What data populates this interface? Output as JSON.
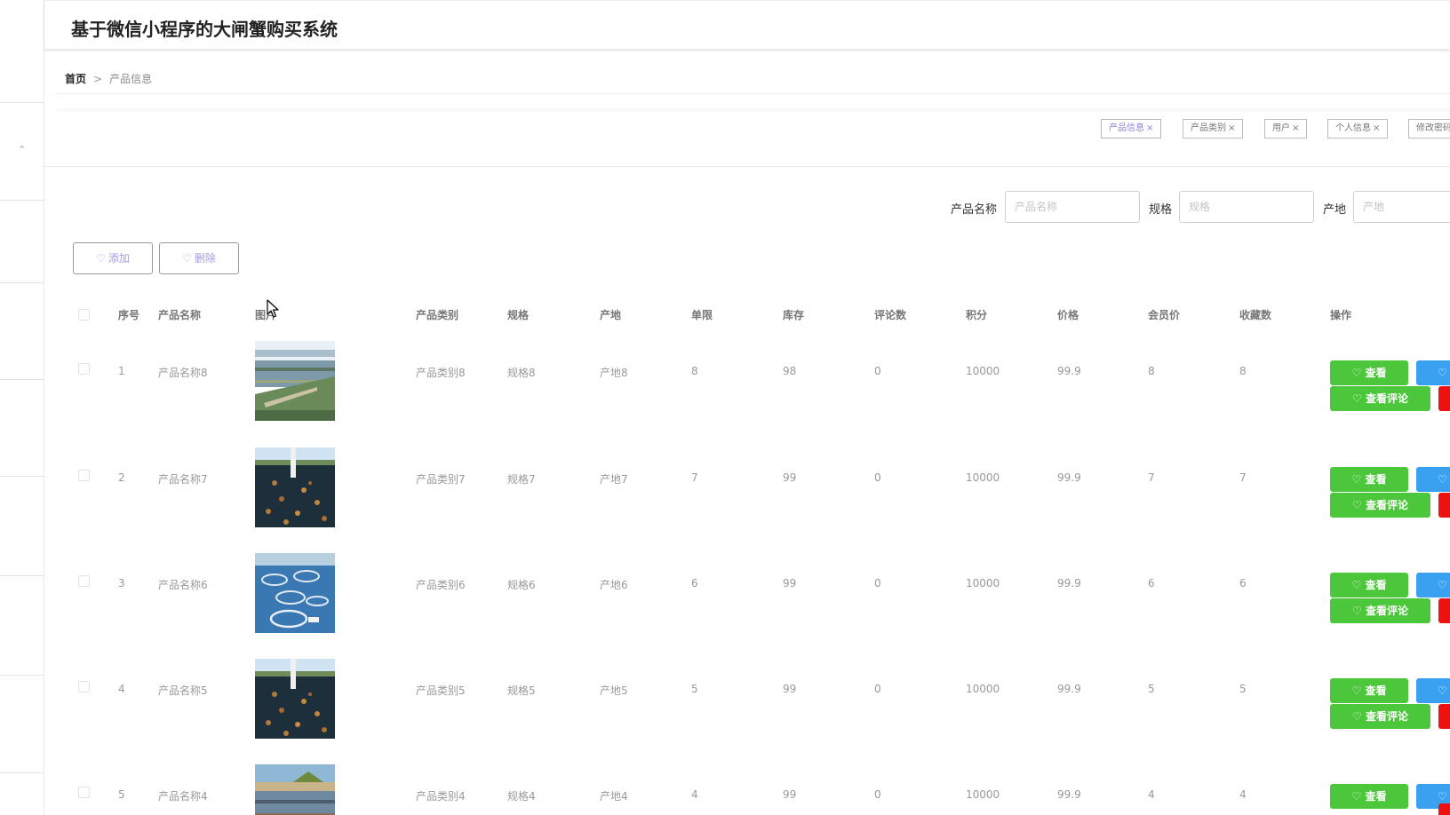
{
  "app_title": "基于微信小程序的大闸蟹购买系统",
  "breadcrumb": {
    "home": "首页",
    "separator": ">",
    "current": "产品信息"
  },
  "tags": [
    {
      "label": "产品信息",
      "active": true
    },
    {
      "label": "产品类别",
      "active": false
    },
    {
      "label": "用户",
      "active": false
    },
    {
      "label": "个人信息",
      "active": false
    },
    {
      "label": "修改密码",
      "active": false
    }
  ],
  "tag_close": "×",
  "search": {
    "name_label": "产品名称",
    "name_placeholder": "产品名称",
    "spec_label": "规格",
    "spec_placeholder": "规格",
    "origin_label": "产地",
    "origin_placeholder": "产地"
  },
  "actions": {
    "add": "添加",
    "delete": "删除"
  },
  "table": {
    "headers": [
      "序号",
      "产品名称",
      "图片",
      "产品类别",
      "规格",
      "产地",
      "单限",
      "库存",
      "评论数",
      "积分",
      "价格",
      "会员价",
      "收藏数",
      "操作"
    ],
    "rows": [
      {
        "no": "1",
        "name": "产品名称8",
        "category": "产品类别8",
        "spec": "规格8",
        "origin": "产地8",
        "limit": "8",
        "stock": "98",
        "comments": "0",
        "points": "10000",
        "price": "99.9",
        "member_price": "8",
        "favorites": "8",
        "image": "aerial-pond"
      },
      {
        "no": "2",
        "name": "产品名称7",
        "category": "产品类别7",
        "spec": "规格7",
        "origin": "产地7",
        "limit": "7",
        "stock": "99",
        "comments": "0",
        "points": "10000",
        "price": "99.9",
        "member_price": "7",
        "favorites": "7",
        "image": "fish-water"
      },
      {
        "no": "3",
        "name": "产品名称6",
        "category": "产品类别6",
        "spec": "规格6",
        "origin": "产地6",
        "limit": "6",
        "stock": "99",
        "comments": "0",
        "points": "10000",
        "price": "99.9",
        "member_price": "6",
        "favorites": "6",
        "image": "cage-farm"
      },
      {
        "no": "4",
        "name": "产品名称5",
        "category": "产品类别5",
        "spec": "规格5",
        "origin": "产地5",
        "limit": "5",
        "stock": "99",
        "comments": "0",
        "points": "10000",
        "price": "99.9",
        "member_price": "5",
        "favorites": "5",
        "image": "fish-water"
      },
      {
        "no": "5",
        "name": "产品名称4",
        "category": "产品类别4",
        "spec": "规格4",
        "origin": "产地4",
        "limit": "4",
        "stock": "99",
        "comments": "0",
        "points": "10000",
        "price": "99.9",
        "member_price": "4",
        "favorites": "4",
        "image": "coast-village"
      }
    ],
    "op_view": "查看",
    "op_view_comments": "查看评论"
  },
  "colors": {
    "green": "#4cc63a",
    "blue": "#3aa0f0",
    "red": "#ee1111",
    "accent": "#a79be0"
  },
  "icons": {
    "button_icon": "heart-icon",
    "sidebar_toggle": "chevron-up-icon",
    "pointer": "mouse-cursor-icon"
  }
}
